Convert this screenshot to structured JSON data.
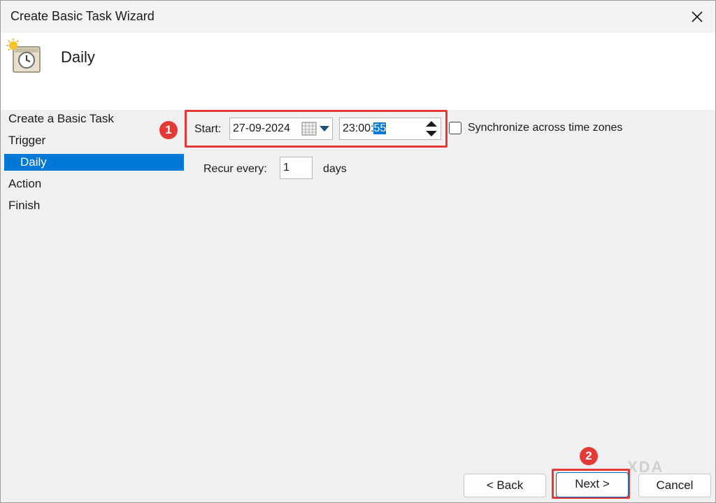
{
  "window": {
    "title": "Create Basic Task Wizard",
    "close_icon": "close-icon"
  },
  "header": {
    "title": "Daily",
    "icon": "clock-scheduler-icon"
  },
  "sidebar": {
    "items": [
      {
        "label": "Create a Basic Task",
        "selected": false
      },
      {
        "label": "Trigger",
        "selected": false
      },
      {
        "label": "Daily",
        "selected": true
      },
      {
        "label": "Action",
        "selected": false
      },
      {
        "label": "Finish",
        "selected": false
      }
    ]
  },
  "trigger": {
    "start_label": "Start:",
    "start_date": "27-09-2024",
    "start_time_prefix": "23:00:",
    "start_time_selected": "55",
    "sync_label": "Synchronize across time zones",
    "sync_checked": false,
    "recur_label": "Recur every:",
    "recur_value": "1",
    "recur_unit": "days"
  },
  "annotations": {
    "badge_1": "1",
    "badge_2": "2",
    "highlight_color": "#e53935"
  },
  "buttons": {
    "back": "< Back",
    "next": "Next >",
    "cancel": "Cancel"
  },
  "watermark": "XDA",
  "colors": {
    "selection": "#0078d7",
    "highlight": "#e53935"
  }
}
